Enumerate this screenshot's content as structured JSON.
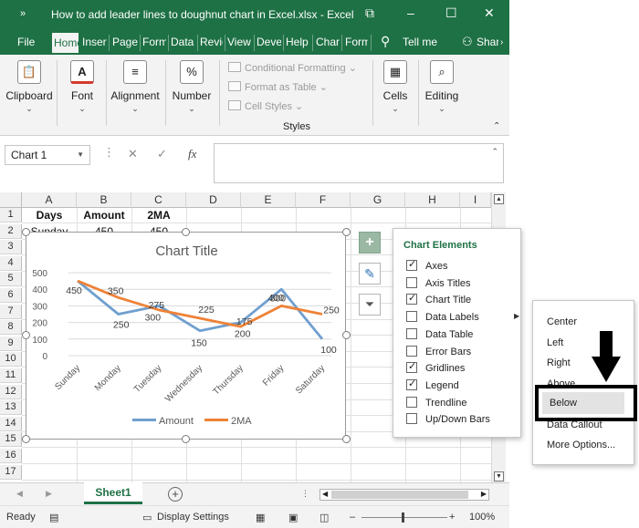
{
  "window": {
    "title": "How to add leader lines to doughnut chart in Excel.xlsx  -  Excel",
    "controls": [
      "⧉",
      "–",
      "☐",
      "✕"
    ]
  },
  "tabs": [
    {
      "label": "File",
      "x": 0
    },
    {
      "label": "Home",
      "active": true
    },
    {
      "label": "Insert"
    },
    {
      "label": "Page Layout"
    },
    {
      "label": "Formulas"
    },
    {
      "label": "Data"
    },
    {
      "label": "Review"
    },
    {
      "label": "View"
    },
    {
      "label": "Developer"
    },
    {
      "label": "Help"
    },
    {
      "label": "Chart Design"
    },
    {
      "label": "Format"
    }
  ],
  "tell_me": "Tell me",
  "share": "Share",
  "ribbon": {
    "clipboard": "Clipboard",
    "font": "Font",
    "alignment": "Alignment",
    "number": "Number",
    "conditional_formatting": "Conditional Formatting",
    "format_as_table": "Format as Table",
    "cell_styles": "Cell Styles",
    "styles": "Styles",
    "cells": "Cells",
    "editing": "Editing"
  },
  "formula_bar": {
    "name_box": "Chart 1",
    "fx": "fx",
    "value": ""
  },
  "columns": [
    "A",
    "B",
    "C",
    "D",
    "E",
    "F",
    "G",
    "H",
    "I"
  ],
  "rows": [
    "1",
    "2",
    "3",
    "4",
    "5",
    "6",
    "7",
    "8",
    "9",
    "10",
    "11",
    "12",
    "13",
    "14",
    "15",
    "16",
    "17"
  ],
  "cells": {
    "a1": "Days",
    "b1": "Amount",
    "c1": "2MA",
    "a2": "Sunday",
    "b2": "450",
    "c2": "450"
  },
  "chart": {
    "title_text": "Chart Title"
  },
  "chart_data": {
    "type": "line",
    "title": "Chart Title",
    "categories": [
      "Sunday",
      "Monday",
      "Tuesday",
      "Wednesday",
      "Thursday",
      "Friday",
      "Saturday"
    ],
    "ylim": [
      0,
      500
    ],
    "yticks": [
      "500",
      "400",
      "300",
      "200",
      "100",
      "0"
    ],
    "grid": true,
    "legend": "bottom",
    "series": [
      {
        "name": "Amount",
        "color": "#6f9fcf",
        "values": [
          450,
          250,
          300,
          150,
          200,
          400,
          100
        ],
        "labels": [
          "450",
          "250",
          "300",
          "150",
          "200",
          "400",
          "100"
        ]
      },
      {
        "name": "2MA",
        "color": "#ee8237",
        "values": [
          450,
          350,
          275,
          225,
          175,
          300,
          250
        ],
        "labels": [
          "",
          "350",
          "275",
          "225",
          "175",
          "300",
          "250"
        ]
      }
    ]
  },
  "chart_elements": {
    "title": "Chart Elements",
    "items": [
      {
        "label": "Axes",
        "checked": true
      },
      {
        "label": "Axis Titles",
        "checked": false
      },
      {
        "label": "Chart Title",
        "checked": true
      },
      {
        "label": "Data Labels",
        "checked": false
      },
      {
        "label": "Data Table",
        "checked": false
      },
      {
        "label": "Error Bars",
        "checked": false
      },
      {
        "label": "Gridlines",
        "checked": true
      },
      {
        "label": "Legend",
        "checked": true
      },
      {
        "label": "Trendline",
        "checked": false
      },
      {
        "label": "Up/Down Bars",
        "checked": false
      }
    ]
  },
  "data_labels_submenu": [
    "Center",
    "Left",
    "Right",
    "Above",
    "Below",
    "Data Callout",
    "More Options..."
  ],
  "sheet": {
    "tab": "Sheet1"
  },
  "status": {
    "ready": "Ready",
    "display_settings": "Display Settings",
    "zoom": "100%"
  }
}
